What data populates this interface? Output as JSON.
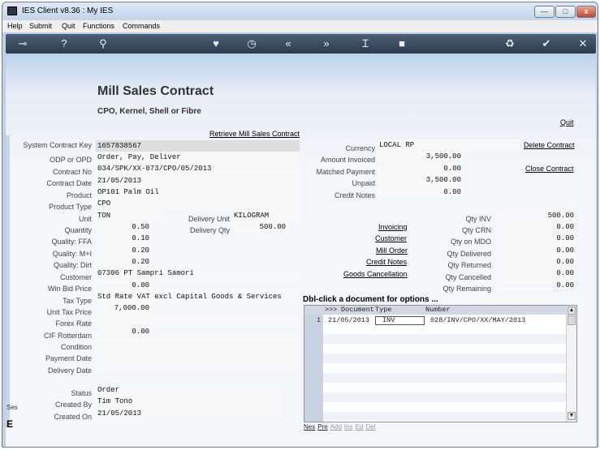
{
  "window": {
    "title": "IES Client v8.36 : My IES",
    "min": "—",
    "max": "□",
    "close": "x"
  },
  "menu": [
    "Help",
    "Submit",
    "Quit",
    "Functions",
    "Commands"
  ],
  "toolbar_icons": [
    "key-icon",
    "help-icon",
    "search-icon",
    "heart-icon",
    "clock-icon",
    "rewind-icon",
    "forward-icon",
    "text-cursor-icon",
    "stop-icon",
    "recycle-icon",
    "check-icon",
    "close-icon"
  ],
  "page": {
    "title": "Mill Sales Contract",
    "subtitle": "CPO, Kernel, Shell or Fibre"
  },
  "links": {
    "quit": "Quit",
    "retrieve": "Retrieve Mill Sales Contract",
    "delete": "Delete Contract",
    "close": "Close Contract",
    "invoicing": "Invoicing",
    "customer": "Customer",
    "mill_order": "Mill Order",
    "credit_notes": "Credit Notes",
    "goods_cancellation": "Goods Cancellation"
  },
  "left_fields": {
    "system_contract_key": {
      "label": "System Contract Key",
      "value": "1657838567"
    },
    "odp_or_opd": {
      "label": "ODP or OPD",
      "value": "Order, Pay, Deliver"
    },
    "contract_no": {
      "label": "Contract No",
      "value": "034/SPK/XX-073/CPO/05/2013"
    },
    "contract_date": {
      "label": "Contract Date",
      "value": "21/05/2013"
    },
    "product": {
      "label": "Product",
      "value": "OP101 Palm Oil"
    },
    "product_type": {
      "label": "Product Type",
      "value": "CPO"
    },
    "unit": {
      "label": "Unit",
      "value": "TON"
    },
    "delivery_unit": {
      "label": "Delivery Unit",
      "value": "KILOGRAM"
    },
    "quantity": {
      "label": "Quantity",
      "value": "0.50"
    },
    "delivery_qty": {
      "label": "Delivery Qty",
      "value": "500.00"
    },
    "quality_ffa": {
      "label": "Quality: FFA",
      "value": "0.10"
    },
    "quality_mi": {
      "label": "Quality: M+I",
      "value": "0.20"
    },
    "quality_dirt": {
      "label": "Quality: Dirt",
      "value": "0.20"
    },
    "customer": {
      "label": "Customer",
      "value": "07306 PT Sampri Samori"
    },
    "win_bid_price": {
      "label": "Win Bid Price",
      "value": "0.00"
    },
    "tax_type": {
      "label": "Tax Type",
      "value": "Std Rate VAT excl Capital Goods & Services"
    },
    "unit_tax_price": {
      "label": "Unit Tax Price",
      "value": "7,000.00"
    },
    "forex_rate": {
      "label": "Forex Rate",
      "value": ""
    },
    "cif_rotterdam": {
      "label": "CIF Rotterdam",
      "value": "0.00"
    },
    "condition": {
      "label": "Condition",
      "value": ""
    },
    "payment_date": {
      "label": "Payment Date",
      "value": ""
    },
    "delivery_date": {
      "label": "Delivery Date",
      "value": ""
    },
    "status": {
      "label": "Status",
      "value": "Order"
    },
    "created_by": {
      "label": "Created By",
      "value": "Tim Tono"
    },
    "created_on": {
      "label": "Created On",
      "value": "21/05/2013"
    }
  },
  "right_fields": {
    "currency": {
      "label": "Currency",
      "value": "LOCAL RP"
    },
    "amount_invoiced": {
      "label": "Amount Invoiced",
      "value": "3,500.00"
    },
    "matched_payment": {
      "label": "Matched Payment",
      "value": "0.00"
    },
    "unpaid": {
      "label": "Unpaid",
      "value": "3,500.00"
    },
    "credit_notes": {
      "label": "Credit Notes",
      "value": "0.00"
    },
    "qty_inv": {
      "label": "Qty INV",
      "value": "500.00"
    },
    "qty_crn": {
      "label": "Qty CRN",
      "value": "0.00"
    },
    "qty_on_mdo": {
      "label": "Qty on MDO",
      "value": "0.00"
    },
    "qty_delivered": {
      "label": "Qty Delivered",
      "value": "0.00"
    },
    "qty_returned": {
      "label": "Qty Returned",
      "value": "0.00"
    },
    "qty_cancelled": {
      "label": "Qty Cancelled",
      "value": "0.00"
    },
    "qty_remaining": {
      "label": "Qty Remaining",
      "value": "0.00"
    }
  },
  "doc_grid": {
    "caption": "Dbl-click a document for options ...",
    "headers": {
      "marker": ">>>",
      "document": "Document",
      "type": "Type",
      "number": "Number"
    },
    "rows": [
      {
        "idx": "1",
        "document": "21/05/2013",
        "type": "INV",
        "number": "028/INV/CPO/XX/MAY/2013"
      }
    ],
    "nav": [
      "Nex",
      "Pre",
      "Add",
      "Ins",
      "Ed",
      "Del"
    ],
    "scroll_up": "▲",
    "scroll_down": "▼"
  },
  "cutoff": {
    "side_text": "Ses",
    "side_letter": "E"
  }
}
